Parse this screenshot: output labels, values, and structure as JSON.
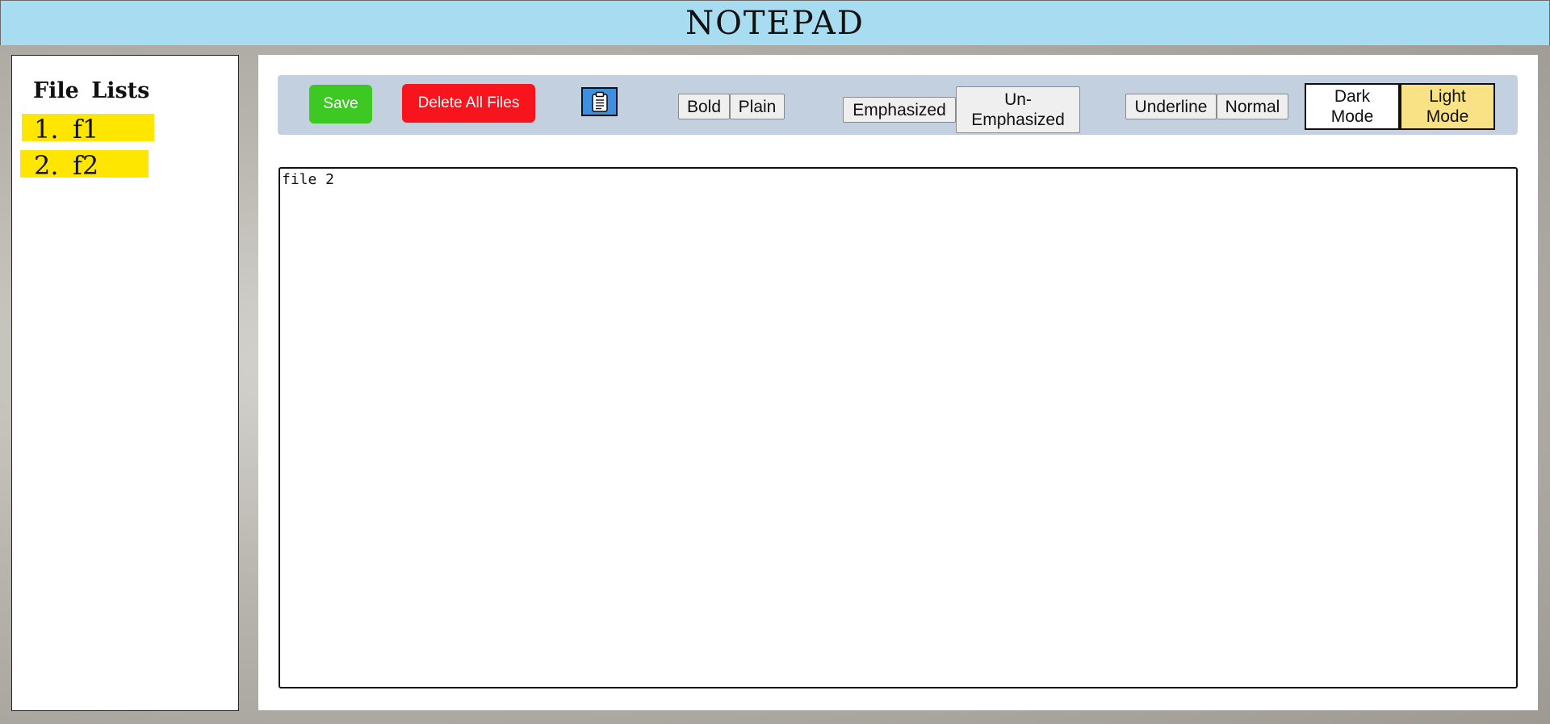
{
  "app": {
    "title": "NOTEPAD"
  },
  "sidebar": {
    "heading": "File Lists",
    "files": [
      {
        "number": "1.",
        "name": "f1"
      },
      {
        "number": "2.",
        "name": "f2"
      }
    ]
  },
  "toolbar": {
    "save_label": "Save",
    "delete_all_label": "Delete All Files",
    "clipboard_icon": "clipboard-icon",
    "bold_label": "Bold",
    "plain_label": "Plain",
    "emphasized_label": "Emphasized",
    "unemphasized_label_line1": "Un-",
    "unemphasized_label_line2": "Emphasized",
    "underline_label": "Underline",
    "normal_label": "Normal",
    "dark_mode_label_line1": "Dark",
    "dark_mode_label_line2": "Mode",
    "light_mode_label_line1": "Light",
    "light_mode_label_line2": "Mode"
  },
  "editor": {
    "content": "file 2"
  },
  "colors": {
    "header_bg": "#a8dcf0",
    "file_item_bg": "#ffe600",
    "save_bg": "#3ec824",
    "delete_bg": "#f7141c",
    "clipboard_bg": "#3d8fe0",
    "toolbar_bg": "#c3d0df",
    "light_mode_bg": "#f9e285",
    "dark_mode_bg": "#ffffff"
  }
}
